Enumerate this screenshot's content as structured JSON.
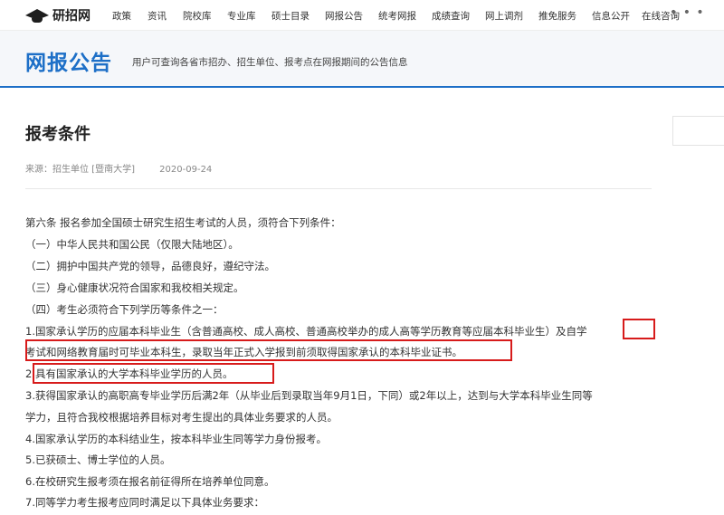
{
  "site": {
    "logo_text": "研招网"
  },
  "nav": {
    "items": [
      "政策",
      "资讯",
      "院校库",
      "专业库",
      "硕士目录",
      "网报公告",
      "统考网报",
      "成绩查询",
      "网上调剂",
      "推免服务",
      "信息公开",
      "在线咨询"
    ],
    "more": "• • •"
  },
  "header": {
    "title": "网报公告",
    "subtitle": "用户可查询各省市招办、招生单位、报考点在网报期间的公告信息"
  },
  "article": {
    "title": "报考条件",
    "source": "来源：招生单位 [暨南大学]",
    "date": "2020-09-24",
    "lines": [
      "第六条 报名参加全国硕士研究生招生考试的人员，须符合下列条件：",
      "（一）中华人民共和国公民（仅限大陆地区）。",
      "（二）拥护中国共产党的领导，品德良好，遵纪守法。",
      "（三）身心健康状况符合国家和我校相关规定。",
      "（四）考生必须符合下列学历等条件之一：",
      "1.国家承认学历的应届本科毕业生（含普通高校、成人高校、普通高校举办的成人高等学历教育等应届本科毕业生）及自学",
      "考试和网络教育届时可毕业本科生，录取当年正式入学报到前须取得国家承认的本科毕业证书。",
      "2.具有国家承认的大学本科毕业学历的人员。",
      "3.获得国家承认的高职高专毕业学历后满2年（从毕业后到录取当年9月1日，下同）或2年以上，达到与大学本科毕业生同等",
      "学力，且符合我校根据培养目标对考生提出的具体业务要求的人员。",
      "4.国家承认学历的本科结业生，按本科毕业生同等学力身份报考。",
      "5.已获硕士、博士学位的人员。",
      "6.在校研究生报考须在报名前征得所在培养单位同意。",
      "7.同等学力考生报考应同时满足以下具体业务要求："
    ]
  },
  "colors": {
    "accent": "#1d6fc7",
    "highlight": "#d71b1b"
  }
}
